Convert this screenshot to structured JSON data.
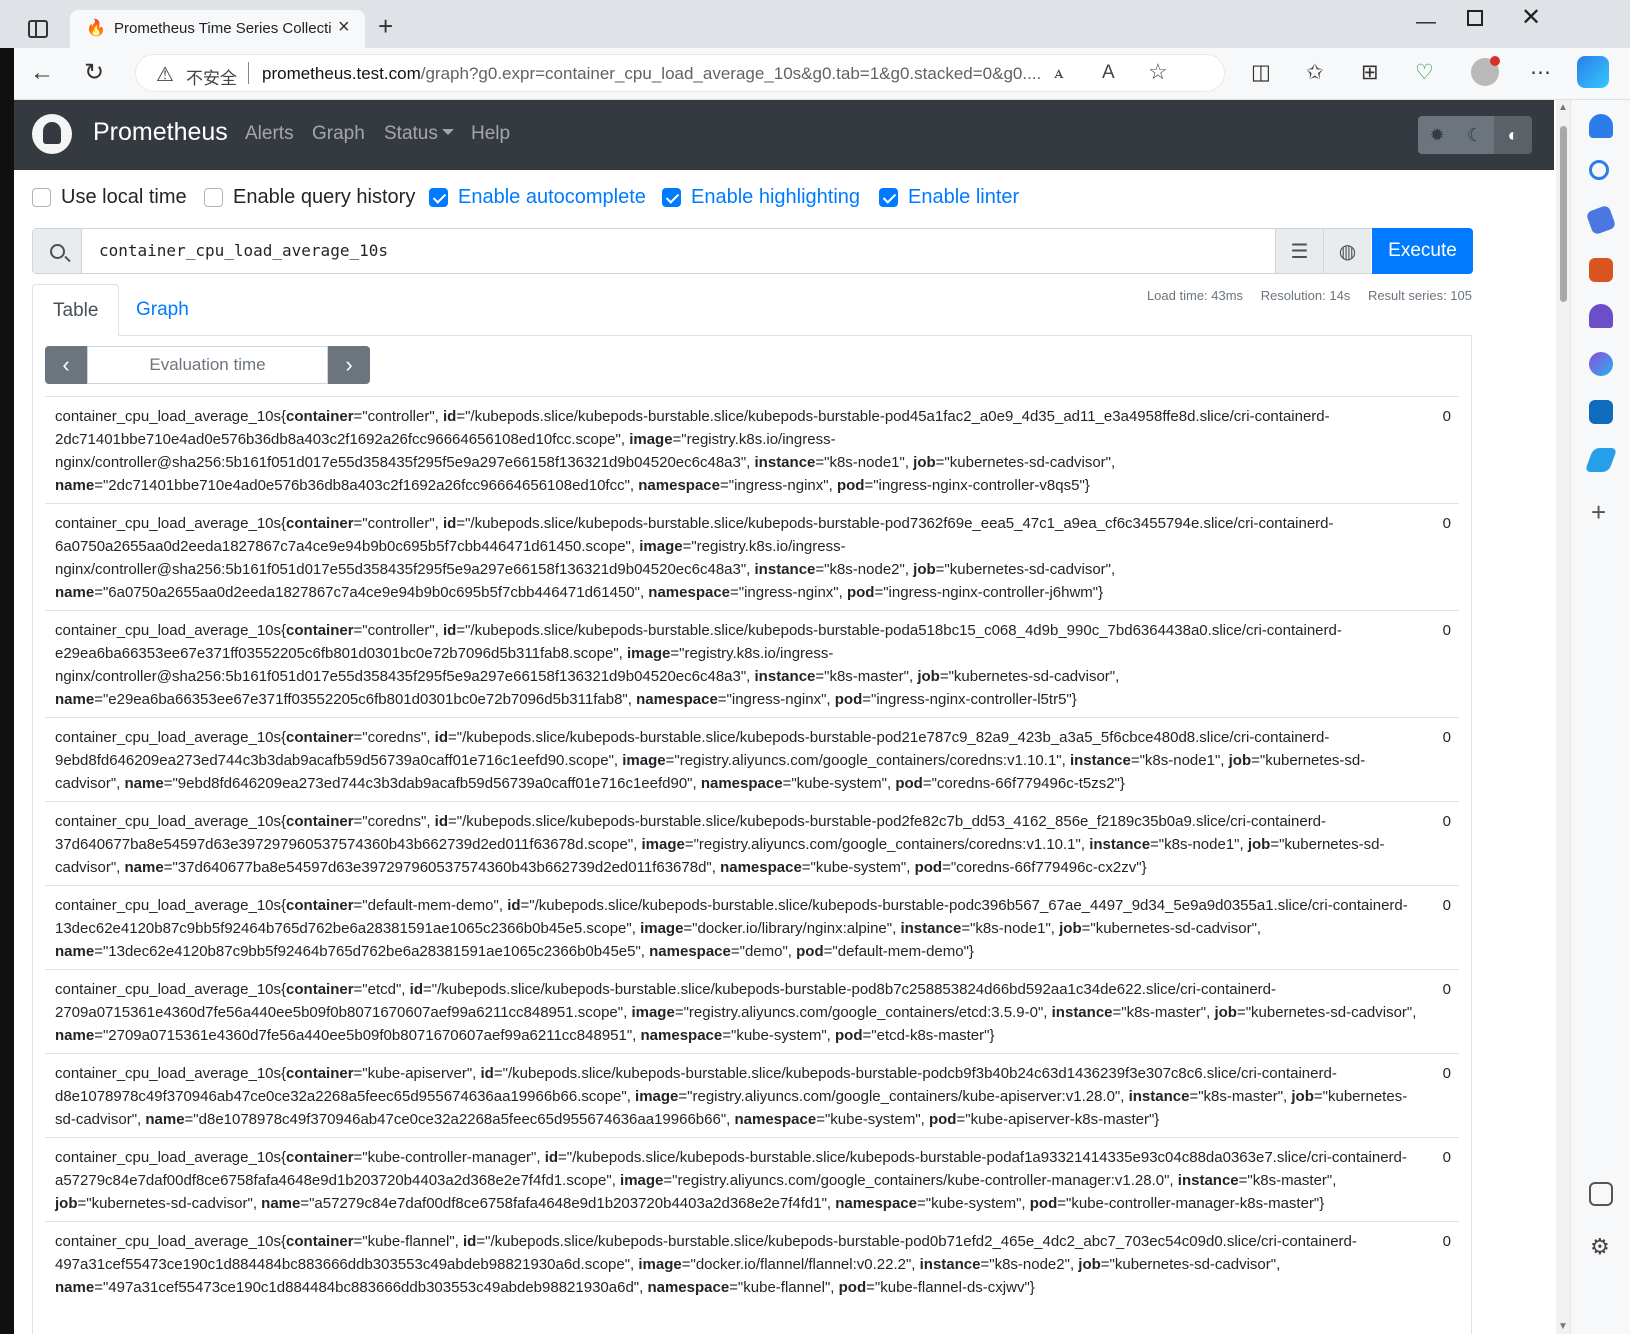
{
  "browser": {
    "tab_title": "Prometheus Time Series Collection",
    "tab_close": "×",
    "new_tab": "+",
    "security_label": "不安全",
    "url_host": "prometheus.test.com",
    "url_rest": "/graph?g0.expr=container_cpu_load_average_10s&g0.tab=1&g0.stacked=0&g0...."
  },
  "app": {
    "brand": "Prometheus",
    "nav": {
      "alerts": "Alerts",
      "graph": "Graph",
      "status": "Status",
      "help": "Help"
    },
    "options": {
      "use_local_time": {
        "label": "Use local time",
        "checked": false
      },
      "enable_query_history": {
        "label": "Enable query history",
        "checked": false
      },
      "enable_autocomplete": {
        "label": "Enable autocomplete",
        "checked": true
      },
      "enable_highlighting": {
        "label": "Enable highlighting",
        "checked": true
      },
      "enable_linter": {
        "label": "Enable linter",
        "checked": true
      }
    },
    "query": "container_cpu_load_average_10s",
    "execute_label": "Execute",
    "tabs": {
      "table": "Table",
      "graph": "Graph"
    },
    "stats": {
      "load_time": "Load time: 43ms",
      "resolution": "Resolution: 14s",
      "result_series": "Result series: 105"
    },
    "eval_placeholder": "Evaluation time"
  },
  "metric": "container_cpu_load_average_10s",
  "results": [
    {
      "labels": [
        [
          "container",
          "controller"
        ],
        [
          "id",
          "/kubepods.slice/kubepods-burstable.slice/kubepods-burstable-pod45a1fac2_a0e9_4d35_ad11_e3a4958ffe8d.slice/cri-containerd-2dc71401bbe710e4ad0e576b36db8a403c2f1692a26fcc96664656108ed10fcc.scope"
        ],
        [
          "image",
          "registry.k8s.io/ingress-nginx/controller@sha256:5b161f051d017e55d358435f295f5e9a297e66158f136321d9b04520ec6c48a3"
        ],
        [
          "instance",
          "k8s-node1"
        ],
        [
          "job",
          "kubernetes-sd-cadvisor"
        ],
        [
          "name",
          "2dc71401bbe710e4ad0e576b36db8a403c2f1692a26fcc96664656108ed10fcc"
        ],
        [
          "namespace",
          "ingress-nginx"
        ],
        [
          "pod",
          "ingress-nginx-controller-v8qs5"
        ]
      ],
      "value": "0"
    },
    {
      "labels": [
        [
          "container",
          "controller"
        ],
        [
          "id",
          "/kubepods.slice/kubepods-burstable.slice/kubepods-burstable-pod7362f69e_eea5_47c1_a9ea_cf6c3455794e.slice/cri-containerd-6a0750a2655aa0d2eeda1827867c7a4ce9e94b9b0c695b5f7cbb446471d61450.scope"
        ],
        [
          "image",
          "registry.k8s.io/ingress-nginx/controller@sha256:5b161f051d017e55d358435f295f5e9a297e66158f136321d9b04520ec6c48a3"
        ],
        [
          "instance",
          "k8s-node2"
        ],
        [
          "job",
          "kubernetes-sd-cadvisor"
        ],
        [
          "name",
          "6a0750a2655aa0d2eeda1827867c7a4ce9e94b9b0c695b5f7cbb446471d61450"
        ],
        [
          "namespace",
          "ingress-nginx"
        ],
        [
          "pod",
          "ingress-nginx-controller-j6hwm"
        ]
      ],
      "value": "0"
    },
    {
      "labels": [
        [
          "container",
          "controller"
        ],
        [
          "id",
          "/kubepods.slice/kubepods-burstable.slice/kubepods-burstable-poda518bc15_c068_4d9b_990c_7bd6364438a0.slice/cri-containerd-e29ea6ba66353ee67e371ff03552205c6fb801d0301bc0e72b7096d5b311fab8.scope"
        ],
        [
          "image",
          "registry.k8s.io/ingress-nginx/controller@sha256:5b161f051d017e55d358435f295f5e9a297e66158f136321d9b04520ec6c48a3"
        ],
        [
          "instance",
          "k8s-master"
        ],
        [
          "job",
          "kubernetes-sd-cadvisor"
        ],
        [
          "name",
          "e29ea6ba66353ee67e371ff03552205c6fb801d0301bc0e72b7096d5b311fab8"
        ],
        [
          "namespace",
          "ingress-nginx"
        ],
        [
          "pod",
          "ingress-nginx-controller-l5tr5"
        ]
      ],
      "value": "0"
    },
    {
      "labels": [
        [
          "container",
          "coredns"
        ],
        [
          "id",
          "/kubepods.slice/kubepods-burstable.slice/kubepods-burstable-pod21e787c9_82a9_423b_a3a5_5f6cbce480d8.slice/cri-containerd-9ebd8fd646209ea273ed744c3b3dab9acafb59d56739a0caff01e716c1eefd90.scope"
        ],
        [
          "image",
          "registry.aliyuncs.com/google_containers/coredns:v1.10.1"
        ],
        [
          "instance",
          "k8s-node1"
        ],
        [
          "job",
          "kubernetes-sd-cadvisor"
        ],
        [
          "name",
          "9ebd8fd646209ea273ed744c3b3dab9acafb59d56739a0caff01e716c1eefd90"
        ],
        [
          "namespace",
          "kube-system"
        ],
        [
          "pod",
          "coredns-66f779496c-t5zs2"
        ]
      ],
      "value": "0"
    },
    {
      "labels": [
        [
          "container",
          "coredns"
        ],
        [
          "id",
          "/kubepods.slice/kubepods-burstable.slice/kubepods-burstable-pod2fe82c7b_dd53_4162_856e_f2189c35b0a9.slice/cri-containerd-37d640677ba8e54597d63e397297960537574360b43b662739d2ed011f63678d.scope"
        ],
        [
          "image",
          "registry.aliyuncs.com/google_containers/coredns:v1.10.1"
        ],
        [
          "instance",
          "k8s-node1"
        ],
        [
          "job",
          "kubernetes-sd-cadvisor"
        ],
        [
          "name",
          "37d640677ba8e54597d63e397297960537574360b43b662739d2ed011f63678d"
        ],
        [
          "namespace",
          "kube-system"
        ],
        [
          "pod",
          "coredns-66f779496c-cx2zv"
        ]
      ],
      "value": "0"
    },
    {
      "labels": [
        [
          "container",
          "default-mem-demo"
        ],
        [
          "id",
          "/kubepods.slice/kubepods-burstable.slice/kubepods-burstable-podc396b567_67ae_4497_9d34_5e9a9d0355a1.slice/cri-containerd-13dec62e4120b87c9bb5f92464b765d762be6a28381591ae1065c2366b0b45e5.scope"
        ],
        [
          "image",
          "docker.io/library/nginx:alpine"
        ],
        [
          "instance",
          "k8s-node1"
        ],
        [
          "job",
          "kubernetes-sd-cadvisor"
        ],
        [
          "name",
          "13dec62e4120b87c9bb5f92464b765d762be6a28381591ae1065c2366b0b45e5"
        ],
        [
          "namespace",
          "demo"
        ],
        [
          "pod",
          "default-mem-demo"
        ]
      ],
      "value": "0"
    },
    {
      "labels": [
        [
          "container",
          "etcd"
        ],
        [
          "id",
          "/kubepods.slice/kubepods-burstable.slice/kubepods-burstable-pod8b7c258853824d66bd592aa1c34de622.slice/cri-containerd-2709a0715361e4360d7fe56a440ee5b09f0b8071670607aef99a6211cc848951.scope"
        ],
        [
          "image",
          "registry.aliyuncs.com/google_containers/etcd:3.5.9-0"
        ],
        [
          "instance",
          "k8s-master"
        ],
        [
          "job",
          "kubernetes-sd-cadvisor"
        ],
        [
          "name",
          "2709a0715361e4360d7fe56a440ee5b09f0b8071670607aef99a6211cc848951"
        ],
        [
          "namespace",
          "kube-system"
        ],
        [
          "pod",
          "etcd-k8s-master"
        ]
      ],
      "value": "0"
    },
    {
      "labels": [
        [
          "container",
          "kube-apiserver"
        ],
        [
          "id",
          "/kubepods.slice/kubepods-burstable.slice/kubepods-burstable-podcb9f3b40b24c63d1436239f3e307c8c6.slice/cri-containerd-d8e1078978c49f370946ab47ce0ce32a2268a5feec65d955674636aa19966b66.scope"
        ],
        [
          "image",
          "registry.aliyuncs.com/google_containers/kube-apiserver:v1.28.0"
        ],
        [
          "instance",
          "k8s-master"
        ],
        [
          "job",
          "kubernetes-sd-cadvisor"
        ],
        [
          "name",
          "d8e1078978c49f370946ab47ce0ce32a2268a5feec65d955674636aa19966b66"
        ],
        [
          "namespace",
          "kube-system"
        ],
        [
          "pod",
          "kube-apiserver-k8s-master"
        ]
      ],
      "value": "0"
    },
    {
      "labels": [
        [
          "container",
          "kube-controller-manager"
        ],
        [
          "id",
          "/kubepods.slice/kubepods-burstable.slice/kubepods-burstable-podaf1a93321414335e93c04c88da0363e7.slice/cri-containerd-a57279c84e7daf00df8ce6758fafa4648e9d1b203720b4403a2d368e2e7f4fd1.scope"
        ],
        [
          "image",
          "registry.aliyuncs.com/google_containers/kube-controller-manager:v1.28.0"
        ],
        [
          "instance",
          "k8s-master"
        ],
        [
          "job",
          "kubernetes-sd-cadvisor"
        ],
        [
          "name",
          "a57279c84e7daf00df8ce6758fafa4648e9d1b203720b4403a2d368e2e7f4fd1"
        ],
        [
          "namespace",
          "kube-system"
        ],
        [
          "pod",
          "kube-controller-manager-k8s-master"
        ]
      ],
      "value": "0"
    },
    {
      "labels": [
        [
          "container",
          "kube-flannel"
        ],
        [
          "id",
          "/kubepods.slice/kubepods-burstable.slice/kubepods-burstable-pod0b71efd2_465e_4dc2_abc7_703ec54c09d0.slice/cri-containerd-497a31cef55473ce190c1d884484bc883666ddb303553c49abdeb98821930a6d.scope"
        ],
        [
          "image",
          "docker.io/flannel/flannel:v0.22.2"
        ],
        [
          "instance",
          "k8s-node2"
        ],
        [
          "job",
          "kubernetes-sd-cadvisor"
        ],
        [
          "name",
          "497a31cef55473ce190c1d884484bc883666ddb303553c49abdeb98821930a6d"
        ],
        [
          "namespace",
          "kube-flannel"
        ],
        [
          "pod",
          "kube-flannel-ds-cxjwv"
        ]
      ],
      "value": "0"
    }
  ],
  "colors": {
    "primary": "#007bff",
    "navbar": "#343a40",
    "secondary": "#6c757d"
  },
  "icons": [
    "window-icon",
    "prometheus-favicon",
    "back-icon",
    "refresh-icon",
    "warning-icon",
    "read-aloud-icon",
    "translate-icon",
    "favorite-star-icon",
    "split-screen-icon",
    "favorites-icon",
    "collections-icon",
    "health-icon",
    "more-icon",
    "copilot-icon",
    "bell-icon",
    "search-icon",
    "tag-icon",
    "toolbox-icon",
    "chess-icon",
    "office-icon",
    "outlook-icon",
    "send-icon",
    "plus-icon",
    "screenshot-icon",
    "gear-icon",
    "prometheus-logo",
    "sun-icon",
    "moon-icon",
    "contrast-icon",
    "format-icon",
    "metrics-explorer-icon"
  ]
}
